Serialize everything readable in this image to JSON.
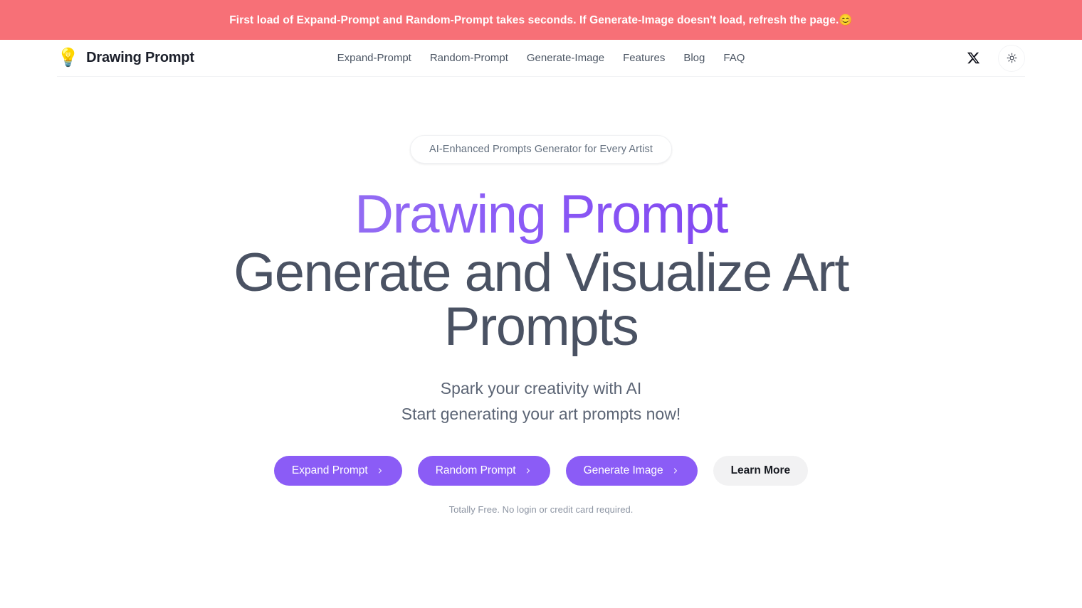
{
  "announcement": {
    "text": "First load of Expand-Prompt and Random-Prompt takes seconds. If Generate-Image doesn't load, refresh the page.😊",
    "background_color": "#F77077",
    "text_color": "#FFFFFF"
  },
  "header": {
    "brand": {
      "logo_icon": "lightbulb-icon",
      "logo_glyph": "💡",
      "name": "Drawing Prompt"
    },
    "nav": [
      {
        "label": "Expand-Prompt"
      },
      {
        "label": "Random-Prompt"
      },
      {
        "label": "Generate-Image"
      },
      {
        "label": "Features"
      },
      {
        "label": "Blog"
      },
      {
        "label": "FAQ"
      }
    ],
    "actions": {
      "social_icon": "x-twitter-icon",
      "theme_toggle_icon": "sun-icon"
    }
  },
  "hero": {
    "badge": "AI-Enhanced Prompts Generator for Every Artist",
    "title_accent": "Drawing Prompt",
    "title_main": "Generate and Visualize Art Prompts",
    "subtitle_line1": "Spark your creativity with AI",
    "subtitle_line2": "Start generating your art prompts now!",
    "buttons": [
      {
        "label": "Expand Prompt",
        "style": "primary",
        "icon": "chevron-right-icon"
      },
      {
        "label": "Random Prompt",
        "style": "primary",
        "icon": "chevron-right-icon"
      },
      {
        "label": "Generate Image",
        "style": "primary",
        "icon": "chevron-right-icon"
      },
      {
        "label": "Learn More",
        "style": "secondary",
        "icon": "none"
      }
    ],
    "note": "Totally Free. No login or credit card required."
  },
  "colors": {
    "accent_purple": "#8B5CF6",
    "accent_purple_light": "#9B7CF0",
    "accent_purple_dark": "#7C3AED",
    "heading_slate": "#4A5263",
    "banner_coral": "#F77077"
  }
}
